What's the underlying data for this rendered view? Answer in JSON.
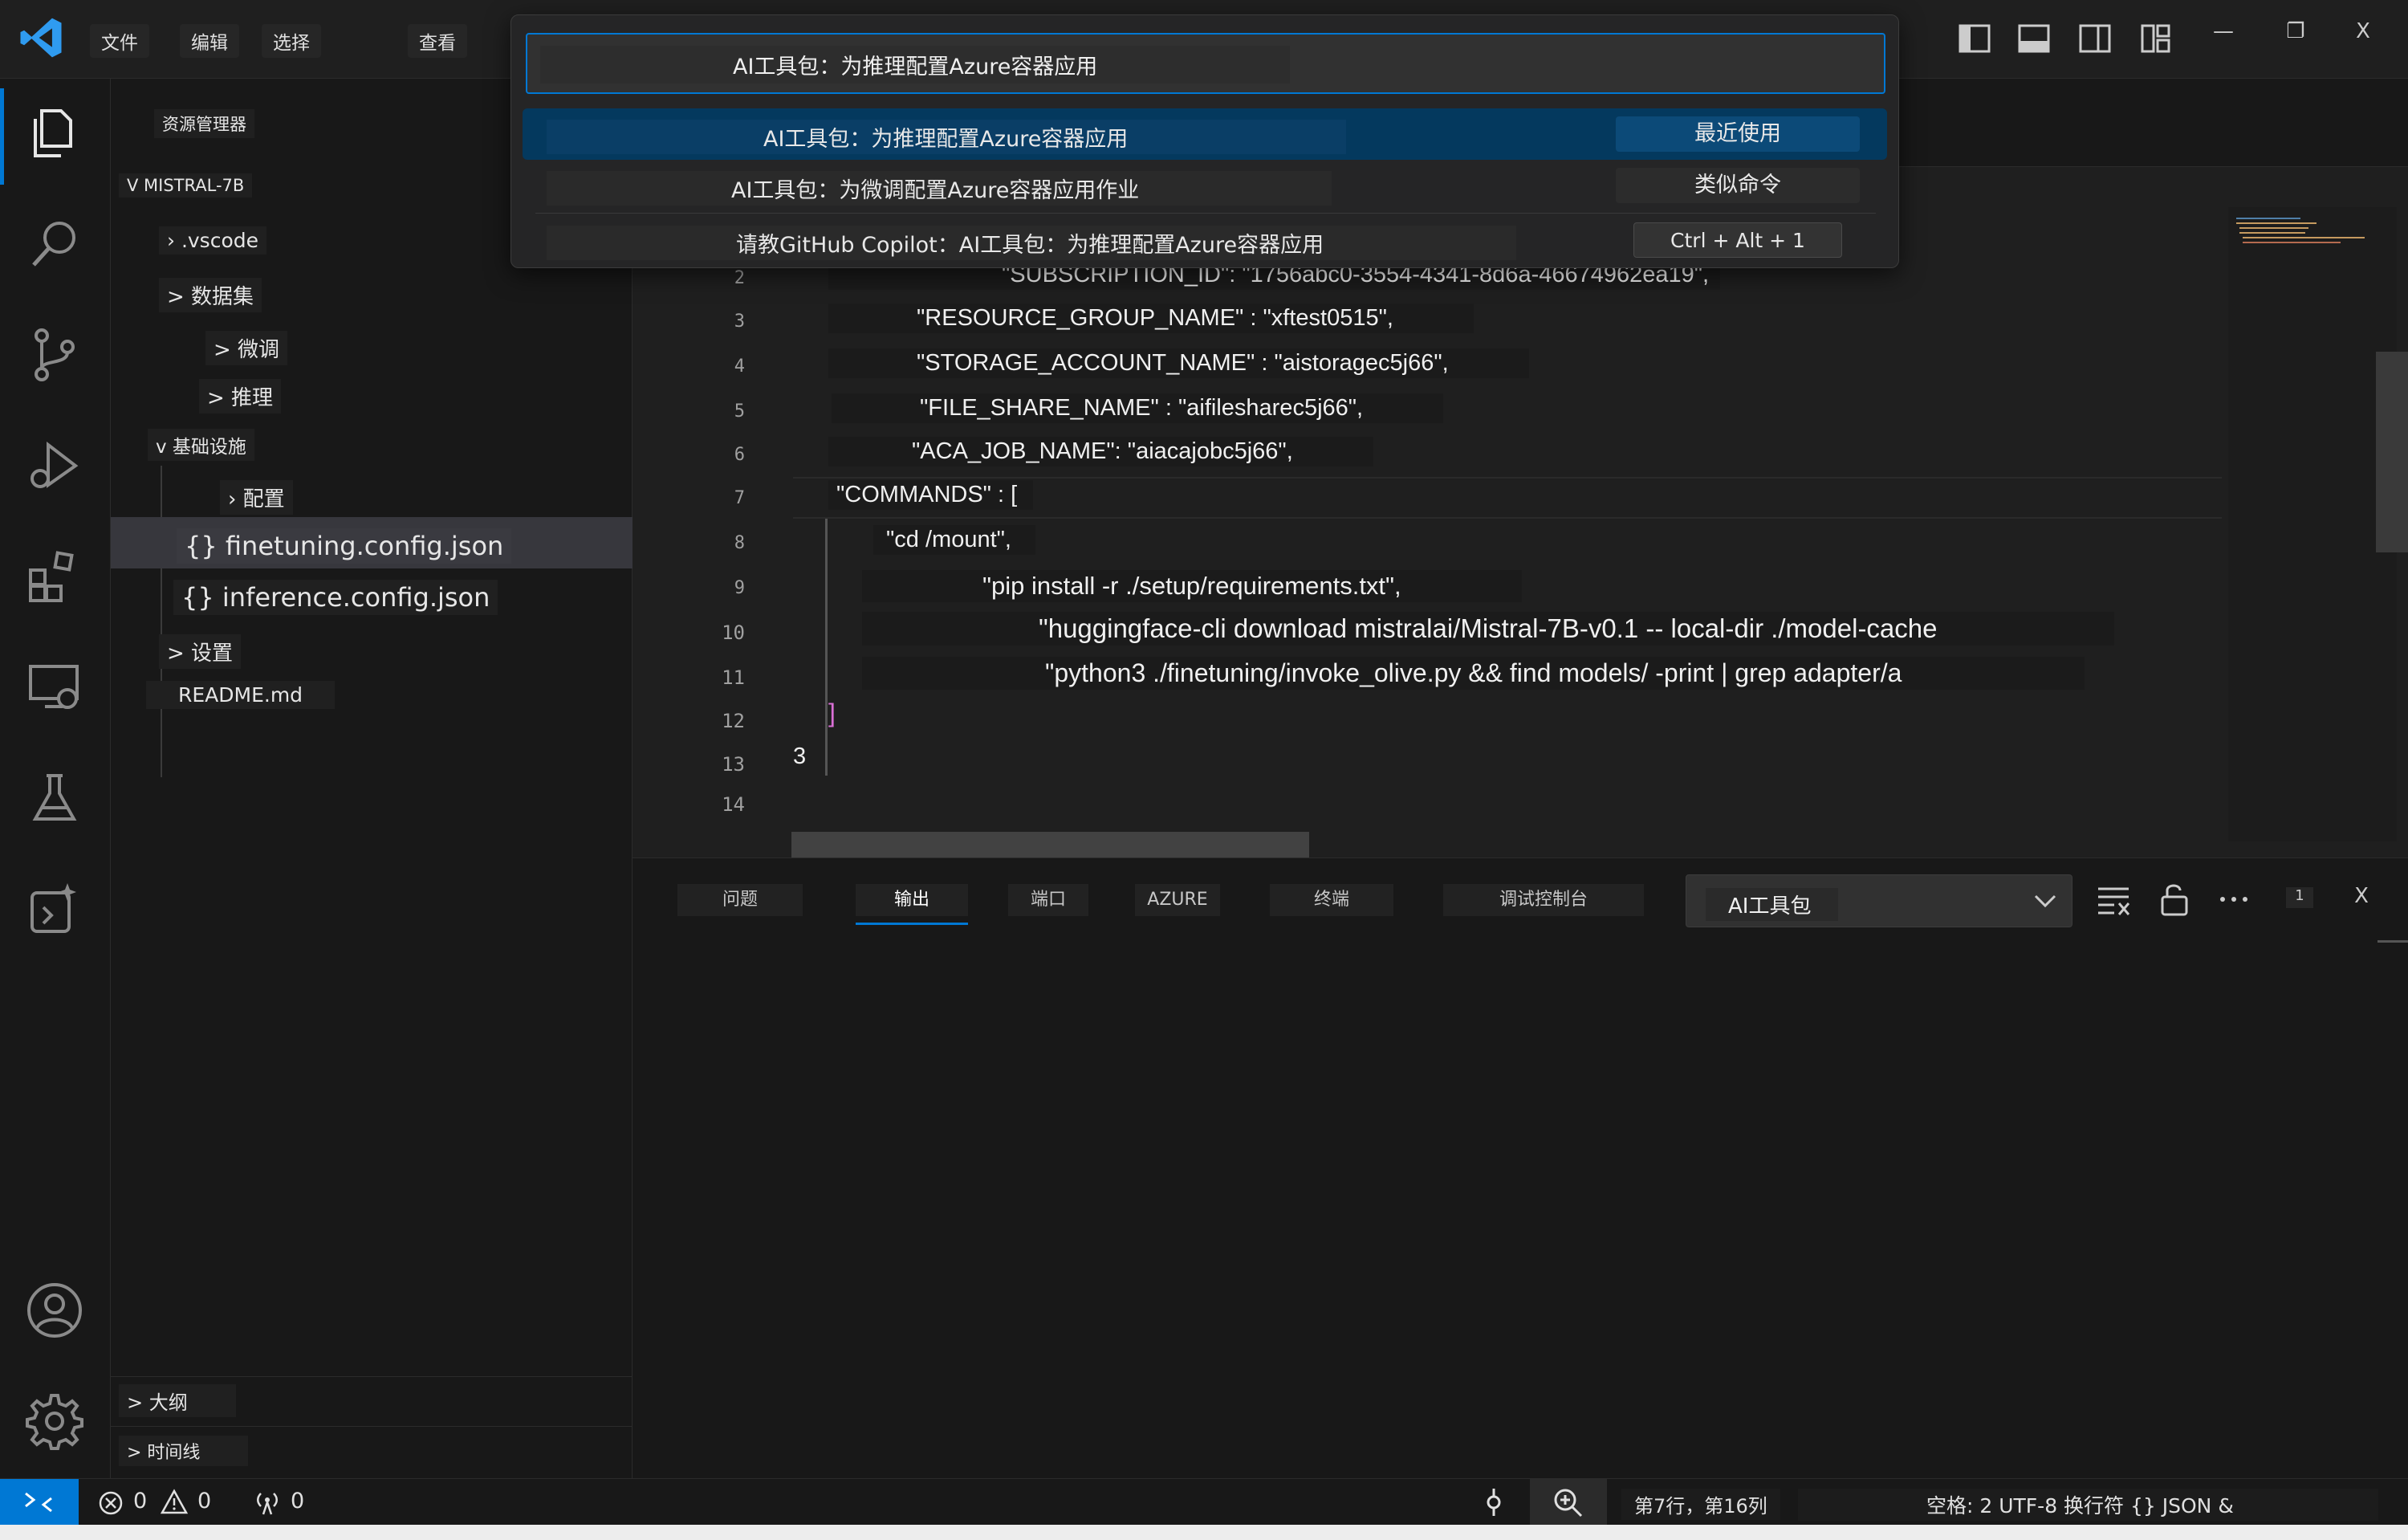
{
  "menu": [
    "文件",
    "编辑",
    "选择",
    "查看"
  ],
  "window_controls": {
    "minimize": "—",
    "restore": "❐",
    "close": "X"
  },
  "command_palette": {
    "input_value": "AI工具包：为推理配置Azure容器应用",
    "results": [
      {
        "label": "AI工具包：为推理配置Azure容器应用",
        "tag": "最近使用",
        "selected": true
      },
      {
        "label": "AI工具包：为微调配置Azure容器应用作业",
        "tag": "类似命令",
        "selected": false
      },
      {
        "label": "请教GitHub Copilot：AI工具包：为推理配置Azure容器应用",
        "tag": "Ctrl + Alt + 1",
        "selected": false
      }
    ]
  },
  "explorer": {
    "title": "资源管理器",
    "more": "...",
    "root": "V MISTRAL-7B",
    "items": {
      "vscode": "› .vscode",
      "dataset": "> 数据集",
      "finetune": "> 微调",
      "inference": "> 推理",
      "infra": "v 基础设施",
      "config": "› 配置",
      "finetuning_json": "{} finetuning.config.json",
      "inference_json": "{} inference.config.json",
      "settings": "> 设置",
      "readme": "README.md"
    },
    "outline": "> 大纲",
    "timeline": "> 时间线"
  },
  "editor": {
    "line_numbers": [
      "2",
      "3",
      "4",
      "5",
      "6",
      "7",
      "8",
      "9",
      "10",
      "11",
      "12",
      "13",
      "14"
    ],
    "lines": {
      "l2": "\"SUBSCRIPTION_ID\": \"1756abc0-3554-4341-8d6a-46674962ea19\",",
      "l3": "\"RESOURCE_GROUP_NAME\" : \"xftest0515\",",
      "l4": "\"STORAGE_ACCOUNT_NAME\" : \"aistoragec5j66\",",
      "l5": "\"FILE_SHARE_NAME\" : \"aifilesharec5j66\",",
      "l6": "\"ACA_JOB_NAME\": \"aiacajobc5j66\",",
      "l7": "\"COMMANDS\" : [",
      "l8": "\"cd /mount\",",
      "l9": "\"pip install -r ./setup/requirements.txt\",",
      "l10": "\"huggingface-cli download mistralai/Mistral-7B-v0.1 -- local-dir ./model-cache",
      "l11": "\"python3 ./finetuning/invoke_olive.py && find models/ -print | grep adapter/a",
      "l12": "]",
      "l13": "3"
    }
  },
  "panel": {
    "tabs": [
      "问题",
      "输出",
      "端口",
      "AZURE",
      "终端",
      "调试控制台"
    ],
    "active_tab": "输出",
    "dropdown_value": "AI工具包",
    "badge": "1",
    "close": "X"
  },
  "statusbar": {
    "errors": "0",
    "warnings": "0",
    "ports": "0",
    "position": "第7行，第16列",
    "info": "空格: 2 UTF-8 换行符 {} JSON &"
  },
  "colors": {
    "accent": "#0078d4",
    "selection": "#04395e",
    "background": "#181818",
    "editor_bg": "#1f1f1f",
    "bracket": "#da70d6"
  }
}
